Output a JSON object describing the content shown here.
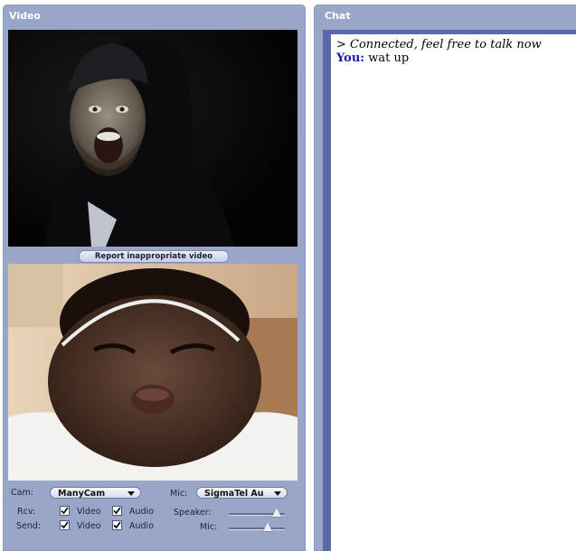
{
  "video_panel": {
    "title": "Video",
    "report_button": "Report inappropriate video",
    "cam_label": "Cam:",
    "cam_selected": "ManyCam",
    "mic_label": "Mic:",
    "mic_selected": "SigmaTel Au",
    "rcv_label": "Rcv:",
    "send_label": "Send:",
    "video_label": "Video",
    "audio_label": "Audio",
    "speaker_label": "Speaker:",
    "mic_level_label": "Mic:",
    "rcv_video_checked": true,
    "rcv_audio_checked": true,
    "send_video_checked": true,
    "send_audio_checked": true,
    "speaker_level": 0.85,
    "mic_level": 0.7
  },
  "chat_panel": {
    "title": "Chat",
    "messages": [
      {
        "type": "system",
        "text": "> Connected, feel free to talk now"
      },
      {
        "type": "user",
        "sender": "You:",
        "text": "wat up"
      }
    ]
  },
  "colors": {
    "panel_bg": "#9aa6c8",
    "chat_border": "#5a6aa8",
    "you_label": "#1a1ab0"
  }
}
